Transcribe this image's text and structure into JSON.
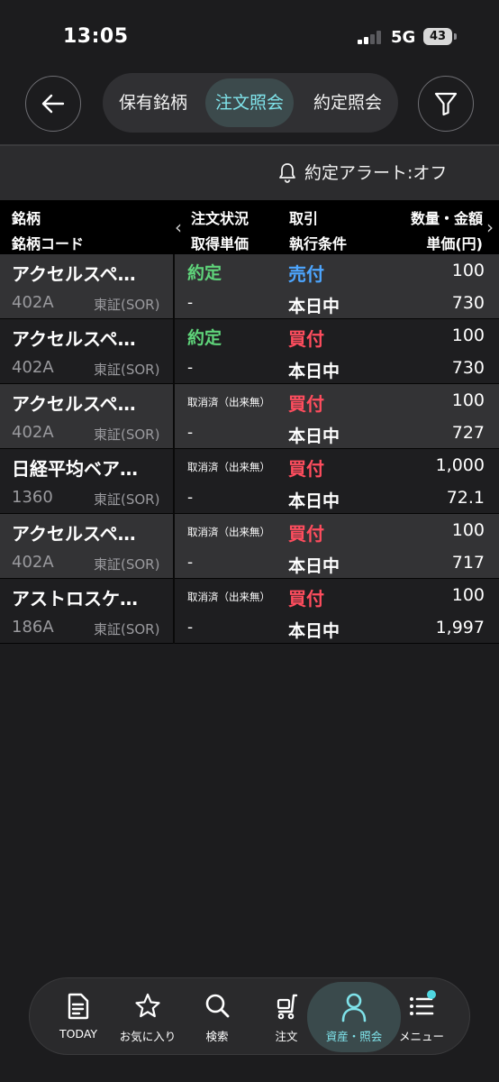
{
  "status_bar": {
    "time": "13:05",
    "network": "5G",
    "battery": "43"
  },
  "header": {
    "tabs": [
      "保有銘柄",
      "注文照会",
      "約定照会"
    ],
    "active_tab": "注文照会",
    "accent_color": "#7fe3ea"
  },
  "alert": {
    "label": "約定アラート:オフ"
  },
  "table": {
    "headers": {
      "name": "銘柄",
      "code": "銘柄コード",
      "status": "注文状況",
      "unit_cost": "取得単価",
      "trade": "取引",
      "condition": "執行条件",
      "qty": "数量・金額",
      "price": "単価(円)"
    },
    "rows": [
      {
        "name": "アクセルスペ…",
        "code": "402A",
        "market": "東証(SOR)",
        "status": "約定",
        "unit_cost": "-",
        "trade": "売付",
        "condition": "本日中",
        "qty": "100",
        "price": "730"
      },
      {
        "name": "アクセルスペ…",
        "code": "402A",
        "market": "東証(SOR)",
        "status": "約定",
        "unit_cost": "-",
        "trade": "買付",
        "condition": "本日中",
        "qty": "100",
        "price": "730"
      },
      {
        "name": "アクセルスペ…",
        "code": "402A",
        "market": "東証(SOR)",
        "status": "取消済（出来無）",
        "unit_cost": "-",
        "trade": "買付",
        "condition": "本日中",
        "qty": "100",
        "price": "727"
      },
      {
        "name": "日経平均ベア…",
        "code": "1360",
        "market": "東証(SOR)",
        "status": "取消済（出来無）",
        "unit_cost": "-",
        "trade": "買付",
        "condition": "本日中",
        "qty": "1,000",
        "price": "72.1"
      },
      {
        "name": "アクセルスペ…",
        "code": "402A",
        "market": "東証(SOR)",
        "status": "取消済（出来無）",
        "unit_cost": "-",
        "trade": "買付",
        "condition": "本日中",
        "qty": "100",
        "price": "717"
      },
      {
        "name": "アストロスケ…",
        "code": "186A",
        "market": "東証(SOR)",
        "status": "取消済（出来無）",
        "unit_cost": "-",
        "trade": "買付",
        "condition": "本日中",
        "qty": "100",
        "price": "1,997"
      }
    ],
    "colors": {
      "filled": "#5fd47a",
      "sell": "#4da6ff",
      "buy": "#ff4d5e"
    }
  },
  "bottom_nav": {
    "items": [
      {
        "label": "TODAY",
        "icon": "document-icon"
      },
      {
        "label": "お気に入り",
        "icon": "star-icon"
      },
      {
        "label": "検索",
        "icon": "search-icon"
      },
      {
        "label": "注文",
        "icon": "cart-icon"
      },
      {
        "label": "資産・照会",
        "icon": "person-icon"
      },
      {
        "label": "メニュー",
        "icon": "menu-icon"
      }
    ],
    "active": "資産・照会"
  }
}
